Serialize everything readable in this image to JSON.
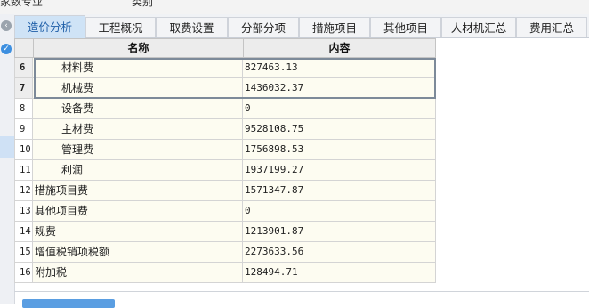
{
  "top": {
    "left_label": "家数专业",
    "mid_label": "类别"
  },
  "tabs": [
    {
      "label": "造价分析",
      "active": true
    },
    {
      "label": "工程概况",
      "active": false
    },
    {
      "label": "取费设置",
      "active": false
    },
    {
      "label": "分部分项",
      "active": false
    },
    {
      "label": "措施项目",
      "active": false
    },
    {
      "label": "其他项目",
      "active": false
    },
    {
      "label": "人材机汇总",
      "active": false
    },
    {
      "label": "费用汇总",
      "active": false
    }
  ],
  "grid": {
    "headers": {
      "name": "名称",
      "value": "内容"
    },
    "rows": [
      {
        "num": "6",
        "name": "材料费",
        "value": "827463.13",
        "indent": true
      },
      {
        "num": "7",
        "name": "机械费",
        "value": "1436032.37",
        "indent": true
      },
      {
        "num": "8",
        "name": "设备费",
        "value": "0",
        "indent": true
      },
      {
        "num": "9",
        "name": "主材费",
        "value": "9528108.75",
        "indent": true
      },
      {
        "num": "10",
        "name": "管理费",
        "value": "1756898.53",
        "indent": true
      },
      {
        "num": "11",
        "name": "利润",
        "value": "1937199.27",
        "indent": true
      },
      {
        "num": "12",
        "name": "措施项目费",
        "value": "1571347.87",
        "indent": false
      },
      {
        "num": "13",
        "name": "其他项目费",
        "value": "0",
        "indent": false
      },
      {
        "num": "14",
        "name": "规费",
        "value": "1213901.87",
        "indent": false
      },
      {
        "num": "15",
        "name": "增值税销项税额",
        "value": "2273633.56",
        "indent": false
      },
      {
        "num": "16",
        "name": "附加税",
        "value": "128494.71",
        "indent": false
      }
    ],
    "selected_rows": [
      "6",
      "7"
    ]
  },
  "colors": {
    "accent": "#1f5fa8",
    "active_tab": "#cfe3f6",
    "cell_bg": "#fdfcf1"
  }
}
